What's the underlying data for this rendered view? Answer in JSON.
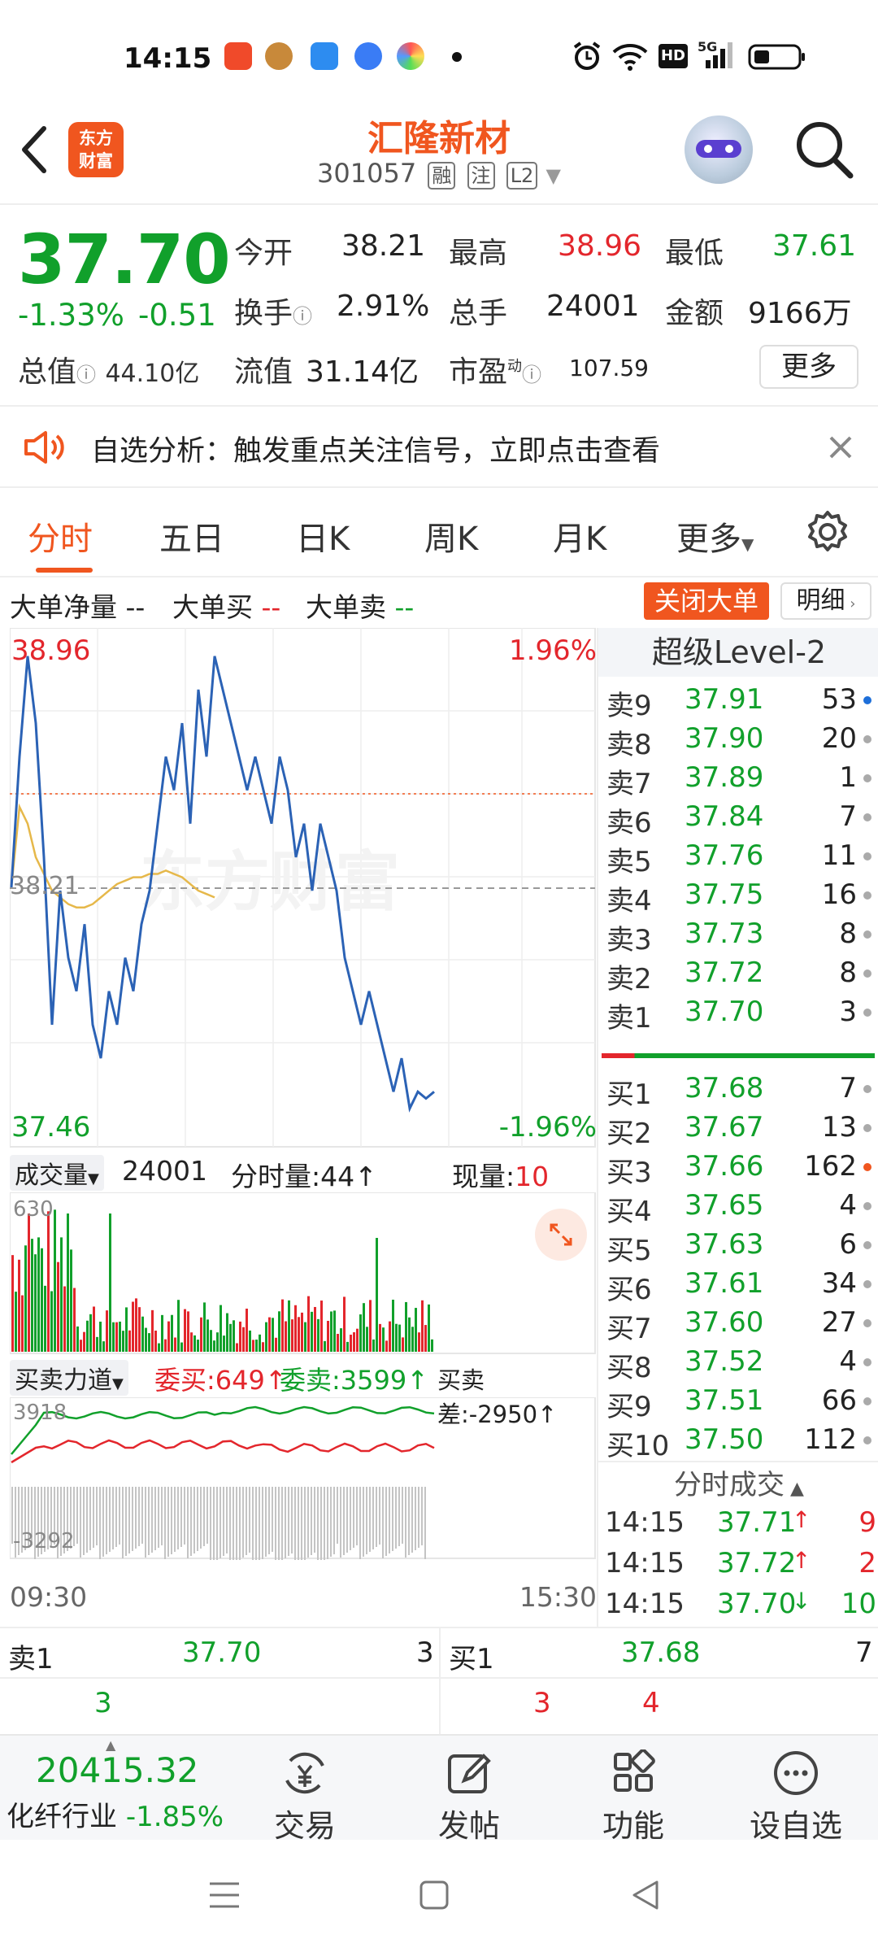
{
  "status_bar": {
    "time": "14:15",
    "network": "5G",
    "hd": "HD"
  },
  "header": {
    "logo_line1": "东方",
    "logo_line2": "财富",
    "stock_name": "汇隆新材",
    "stock_code": "301057",
    "tags": [
      "融",
      "注",
      "L2"
    ]
  },
  "quote": {
    "price": "37.70",
    "change_pct": "-1.33%",
    "change": "-0.51",
    "open_label": "今开",
    "open": "38.21",
    "high_label": "最高",
    "high": "38.96",
    "low_label": "最低",
    "low": "37.61",
    "turnover_label": "换手",
    "turnover": "2.91%",
    "volume_label": "总手",
    "volume": "24001",
    "amount_label": "金额",
    "amount": "9166万",
    "mktcap_label": "总值",
    "mktcap": "44.10亿",
    "float_label": "流值",
    "float": "31.14亿",
    "pe_label": "市盈",
    "pe_sup": "动",
    "pe": "107.59",
    "more_label": "更多"
  },
  "alert": {
    "text": "自选分析：触发重点关注信号，立即点击查看"
  },
  "tabs": {
    "items": [
      "分时",
      "五日",
      "日K",
      "周K",
      "月K",
      "更多"
    ],
    "active": "分时"
  },
  "big_order": {
    "net_label": "大单净量",
    "net_val": "--",
    "buy_label": "大单买",
    "buy_val": "--",
    "sell_label": "大单卖",
    "sell_val": "--",
    "close_btn": "关闭大单",
    "detail_btn": "明细"
  },
  "chart": {
    "price_top": "38.96",
    "price_bottom": "37.46",
    "pct_top": "1.96%",
    "pct_bottom": "-1.96%",
    "open_ref": "38.21",
    "watermark": "东方财富",
    "volume_selector": "成交量",
    "total_volume": "24001",
    "minute_vol_label": "分时量:44",
    "current_vol_label": "现量:",
    "current_vol": "10",
    "vol_max": "630",
    "force_selector": "买卖力道",
    "bid_label": "委买:649",
    "ask_label": "委卖:3599",
    "diff_label": "买卖差:-2950",
    "force_top": "3918",
    "force_bottom": "-3292",
    "time_start": "09:30",
    "time_end": "15:30"
  },
  "chart_data": {
    "type": "line",
    "title": "",
    "xlabel": "",
    "ylabel": "",
    "ylim": [
      37.46,
      38.96
    ],
    "reference": 38.21,
    "series": [
      {
        "values": [
          38.21,
          38.6,
          38.9,
          38.7,
          38.3,
          37.8,
          38.2,
          38.0,
          37.9,
          38.1,
          37.8,
          37.7,
          37.9,
          37.8,
          38.0,
          37.9,
          38.1,
          38.2,
          38.4,
          38.6,
          38.5,
          38.7,
          38.4,
          38.8,
          38.6,
          38.9,
          38.8,
          38.7,
          38.6,
          38.5,
          38.6,
          38.5,
          38.4,
          38.6,
          38.5,
          38.3,
          38.4,
          38.2,
          38.4,
          38.3,
          38.2,
          38.0,
          37.9,
          37.8,
          37.9,
          37.8,
          37.7,
          37.6,
          37.7,
          37.55,
          37.6,
          37.58,
          37.6
        ]
      },
      {
        "values": [
          38.21,
          38.45,
          38.4,
          38.3,
          38.25,
          38.2,
          38.18,
          38.16,
          38.15,
          38.15,
          38.16,
          38.18,
          38.2,
          38.22,
          38.23,
          38.24,
          38.24,
          38.25,
          38.25,
          38.26,
          38.25,
          38.24,
          38.22,
          38.2,
          38.19,
          38.18
        ]
      }
    ]
  },
  "order_book": {
    "title": "超级Level-2",
    "asks": [
      {
        "label": "卖9",
        "price": "37.91",
        "vol": "53",
        "dot": "#1e6fd9"
      },
      {
        "label": "卖8",
        "price": "37.90",
        "vol": "20",
        "dot": "#aaa"
      },
      {
        "label": "卖7",
        "price": "37.89",
        "vol": "1",
        "dot": "#aaa"
      },
      {
        "label": "卖6",
        "price": "37.84",
        "vol": "7",
        "dot": "#aaa"
      },
      {
        "label": "卖5",
        "price": "37.76",
        "vol": "11",
        "dot": "#aaa"
      },
      {
        "label": "卖4",
        "price": "37.75",
        "vol": "16",
        "dot": "#aaa"
      },
      {
        "label": "卖3",
        "price": "37.73",
        "vol": "8",
        "dot": "#aaa"
      },
      {
        "label": "卖2",
        "price": "37.72",
        "vol": "8",
        "dot": "#aaa"
      },
      {
        "label": "卖1",
        "price": "37.70",
        "vol": "3",
        "dot": "#aaa"
      }
    ],
    "bids": [
      {
        "label": "买1",
        "price": "37.68",
        "vol": "7",
        "dot": "#aaa"
      },
      {
        "label": "买2",
        "price": "37.67",
        "vol": "13",
        "dot": "#aaa"
      },
      {
        "label": "买3",
        "price": "37.66",
        "vol": "162",
        "dot": "#f0561f"
      },
      {
        "label": "买4",
        "price": "37.65",
        "vol": "4",
        "dot": "#aaa"
      },
      {
        "label": "买5",
        "price": "37.63",
        "vol": "6",
        "dot": "#aaa"
      },
      {
        "label": "买6",
        "price": "37.61",
        "vol": "34",
        "dot": "#aaa"
      },
      {
        "label": "买7",
        "price": "37.60",
        "vol": "27",
        "dot": "#aaa"
      },
      {
        "label": "买8",
        "price": "37.52",
        "vol": "4",
        "dot": "#aaa"
      },
      {
        "label": "买9",
        "price": "37.51",
        "vol": "66",
        "dot": "#aaa"
      },
      {
        "label": "买10",
        "price": "37.50",
        "vol": "112",
        "dot": "#aaa"
      }
    ],
    "trades_title": "分时成交",
    "trades": [
      {
        "time": "14:15",
        "price": "37.71",
        "dir": "↑",
        "vol": "9",
        "color": "#e3262c"
      },
      {
        "time": "14:15",
        "price": "37.72",
        "dir": "↑",
        "vol": "2",
        "color": "#e3262c"
      },
      {
        "time": "14:15",
        "price": "37.70",
        "dir": "↓",
        "vol": "10",
        "color": "#11a02b"
      }
    ]
  },
  "summary": {
    "sell1_label": "卖1",
    "sell1_price": "37.70",
    "sell1_vol": "3",
    "buy1_label": "买1",
    "buy1_price": "37.68",
    "buy1_vol": "7",
    "row2_a": "3",
    "row2_b": "3",
    "row2_c": "4"
  },
  "bottom_nav": {
    "index_value": "20415.32",
    "index_name": "化纤行业",
    "index_change": "-1.85%",
    "trade": "交易",
    "post": "发帖",
    "functions": "功能",
    "watchlist": "设自选"
  }
}
